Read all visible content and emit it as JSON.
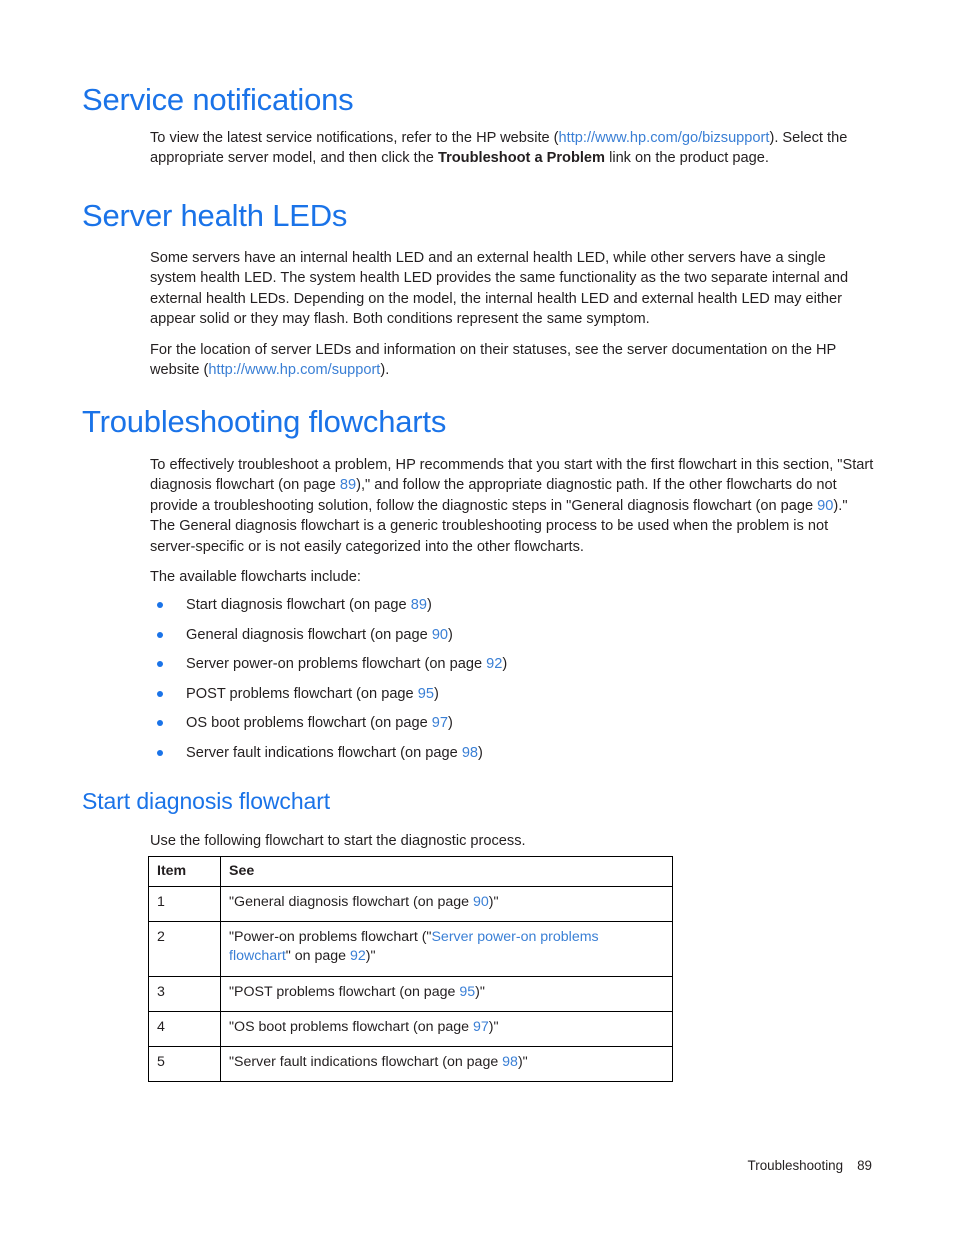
{
  "sections": {
    "service_notifications": {
      "heading": "Service notifications",
      "para_1_a": "To view the latest service notifications, refer to the HP website (",
      "para_1_link": "http://www.hp.com/go/bizsupport",
      "para_1_b": "). Select the appropriate server model, and then click the ",
      "para_1_bold": "Troubleshoot a Problem",
      "para_1_c": " link on the product page."
    },
    "server_health_leds": {
      "heading": "Server health LEDs",
      "para_1": "Some servers have an internal health LED and an external health LED, while other servers have a single system health LED. The system health LED provides the same functionality as the two separate internal and external health LEDs. Depending on the model, the internal health LED and external health LED may either appear solid or they may flash. Both conditions represent the same symptom.",
      "para_2_a": "For the location of server LEDs and information on their statuses, see the server documentation on the HP website (",
      "para_2_link": "http://www.hp.com/support",
      "para_2_b": ")."
    },
    "troubleshooting_flowcharts": {
      "heading": "Troubleshooting flowcharts",
      "para_1_a": "To effectively troubleshoot a problem, HP recommends that you start with the first flowchart in this section, \"Start diagnosis flowchart (on page ",
      "para_1_page_1": "89",
      "para_1_b": "),\" and follow the appropriate diagnostic path. If the other flowcharts do not provide a troubleshooting solution, follow the diagnostic steps in \"General diagnosis flowchart (on page ",
      "para_1_page_2": "90",
      "para_1_c": ").\" The General diagnosis flowchart is a generic troubleshooting process to be used when the problem is not server-specific or is not easily categorized into the other flowcharts.",
      "para_2": "The available flowcharts include:",
      "bullets": [
        {
          "text_before": "Start diagnosis flowchart (on page ",
          "page": "89",
          "text_after": ")"
        },
        {
          "text_before": "General diagnosis flowchart (on page ",
          "page": "90",
          "text_after": ")"
        },
        {
          "text_before": "Server power-on problems flowchart (on page ",
          "page": "92",
          "text_after": ")"
        },
        {
          "text_before": "POST problems flowchart (on page ",
          "page": "95",
          "text_after": ")"
        },
        {
          "text_before": "OS boot problems flowchart (on page ",
          "page": "97",
          "text_after": ")"
        },
        {
          "text_before": "Server fault indications flowchart (on page ",
          "page": "98",
          "text_after": ")"
        }
      ]
    },
    "start_diagnosis_flowchart": {
      "heading": "Start diagnosis flowchart",
      "intro": "Use the following flowchart to start the diagnostic process.",
      "table": {
        "columns": [
          "Item",
          "See"
        ],
        "rows": [
          {
            "item": "1",
            "see_before": "\"General diagnosis flowchart (on page ",
            "see_page": "90",
            "see_after": ")\""
          },
          {
            "item": "2",
            "see_before": "\"Power-on problems flowchart (\"",
            "see_xref": "Server power-on problems flowchart",
            "see_mid": "\" on page ",
            "see_page": "92",
            "see_after": ")\""
          },
          {
            "item": "3",
            "see_before": "\"POST problems flowchart (on page ",
            "see_page": "95",
            "see_after": ")\""
          },
          {
            "item": "4",
            "see_before": "\"OS boot problems flowchart (on page ",
            "see_page": "97",
            "see_after": ")\""
          },
          {
            "item": "5",
            "see_before": "\"Server fault indications flowchart (on page ",
            "see_page": "98",
            "see_after": ")\""
          }
        ]
      }
    }
  },
  "footer": {
    "chapter": "Troubleshooting",
    "page_number": "89"
  },
  "colors": {
    "heading_blue": "#1a73e8",
    "link_blue": "#3a7fd5",
    "body_text": "#231f20",
    "table_border": "#000000",
    "background": "#ffffff"
  }
}
